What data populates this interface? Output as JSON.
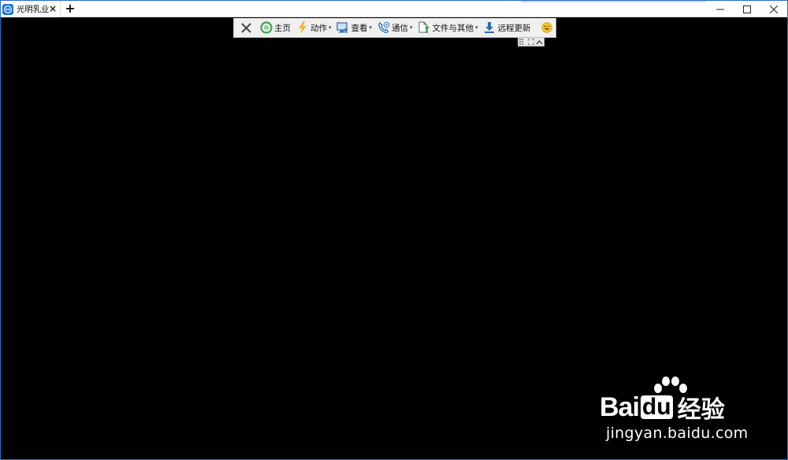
{
  "window": {
    "tab_title": "光明乳业",
    "tab_close_icon": "close-icon",
    "new_tab_icon": "plus-icon",
    "controls": [
      "minimize-icon",
      "maximize-icon",
      "close-icon"
    ],
    "accent_color": "#2b6cc4"
  },
  "toolbar": {
    "items": [
      {
        "name": "close",
        "icon": "close-icon",
        "label": ""
      },
      {
        "name": "home",
        "icon": "home-icon",
        "label": "主页"
      },
      {
        "name": "actions",
        "icon": "lightning-icon",
        "label": "动作",
        "dropdown": true
      },
      {
        "name": "view",
        "icon": "monitor-icon",
        "label": "查看",
        "dropdown": true
      },
      {
        "name": "communicate",
        "icon": "phone-icon",
        "label": "通信",
        "dropdown": true
      },
      {
        "name": "files",
        "icon": "file-icon",
        "label": "文件与其他",
        "dropdown": true
      },
      {
        "name": "remote-update",
        "icon": "download-icon",
        "label": "远程更新"
      },
      {
        "name": "feedback",
        "icon": "smiley-icon",
        "label": ""
      }
    ],
    "caret": "▾"
  },
  "watermark": {
    "brand_left": "Bai",
    "brand_du": "du",
    "brand_cn": "经验",
    "url": "jingyan.baidu.com"
  }
}
